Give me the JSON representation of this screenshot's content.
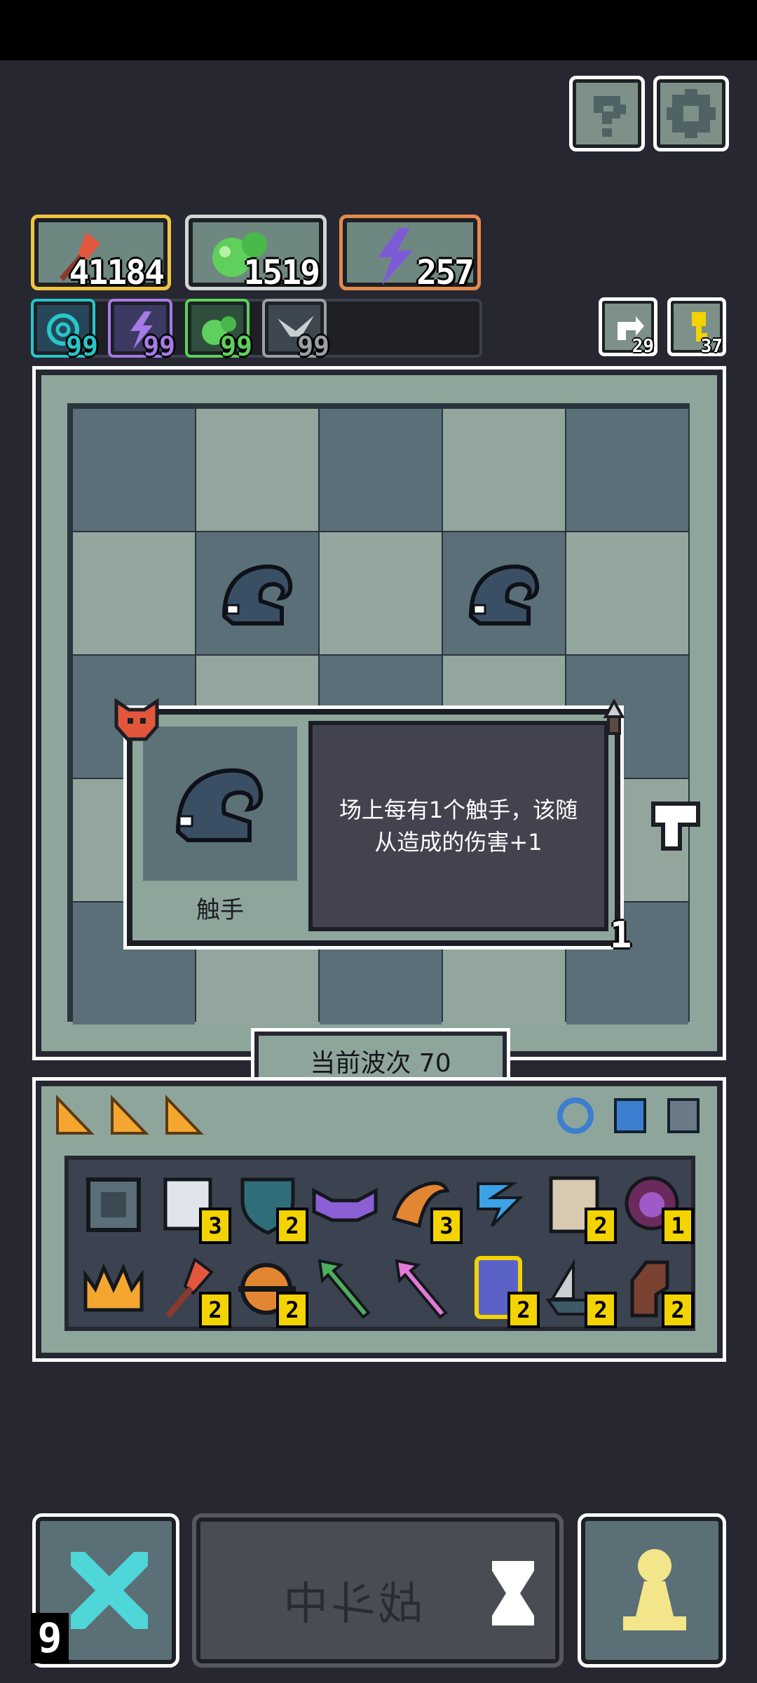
{
  "top_buttons": [
    {
      "name": "help",
      "icon": "question-mark-icon"
    },
    {
      "name": "settings",
      "icon": "gear-icon"
    }
  ],
  "resources": [
    {
      "icon": "axe-icon",
      "value": "41184",
      "border": "#f2c541"
    },
    {
      "icon": "green-blob-icon",
      "value": "1519",
      "border": "#cfd6d4"
    },
    {
      "icon": "lightning-icon",
      "value": "257",
      "border": "#e48a4b"
    }
  ],
  "mini_stats": [
    {
      "icon": "swirl-icon",
      "value": "99",
      "color": "#27c6c9"
    },
    {
      "icon": "purple-lightning-icon",
      "value": "99",
      "color": "#a57be8"
    },
    {
      "icon": "green-blob-icon",
      "value": "99",
      "color": "#5ed05b"
    },
    {
      "icon": "wing-icon",
      "value": "99",
      "color": "#9aa0a5"
    }
  ],
  "side_counters": [
    {
      "icon": "refresh-icon",
      "value": "29"
    },
    {
      "icon": "key-icon",
      "value": "37"
    }
  ],
  "wave": {
    "label": "当前波次 70"
  },
  "popup": {
    "name": "触手",
    "description": "场上每有1个触手，该随从造成的伤害+1",
    "level": "1"
  },
  "inventory": {
    "tabs": [
      "gold-piece-icon",
      "gold-piece-icon",
      "gold-piece-icon"
    ],
    "filters": [
      "blue-ring-icon",
      "blue-helmet-icon",
      "gray-helmet-icon"
    ],
    "row1": [
      {
        "icon": "dark-box-icon",
        "count": ""
      },
      {
        "icon": "scroll-icon",
        "count": "3"
      },
      {
        "icon": "shield-heart-icon",
        "count": "2"
      },
      {
        "icon": "purple-bat-icon",
        "count": ""
      },
      {
        "icon": "horn-icon",
        "count": "3"
      },
      {
        "icon": "blue-wind-icon",
        "count": ""
      },
      {
        "icon": "map-icon",
        "count": "2"
      },
      {
        "icon": "demon-face-icon",
        "count": "1"
      }
    ],
    "row2": [
      {
        "icon": "crown-claw-icon",
        "count": ""
      },
      {
        "icon": "red-axe-icon",
        "count": "2"
      },
      {
        "icon": "orange-orb-icon",
        "count": "2"
      },
      {
        "icon": "green-arrow-icon",
        "count": ""
      },
      {
        "icon": "pink-arrow-icon",
        "count": ""
      },
      {
        "icon": "potion-jar-icon",
        "count": "2"
      },
      {
        "icon": "ship-icon",
        "count": "2"
      },
      {
        "icon": "brown-totem-icon",
        "count": "2"
      }
    ]
  },
  "bottom": {
    "left_count": "9",
    "fight_label": "战斗中",
    "hourglass": "hourglass-icon",
    "pawn": "pawn-icon"
  }
}
